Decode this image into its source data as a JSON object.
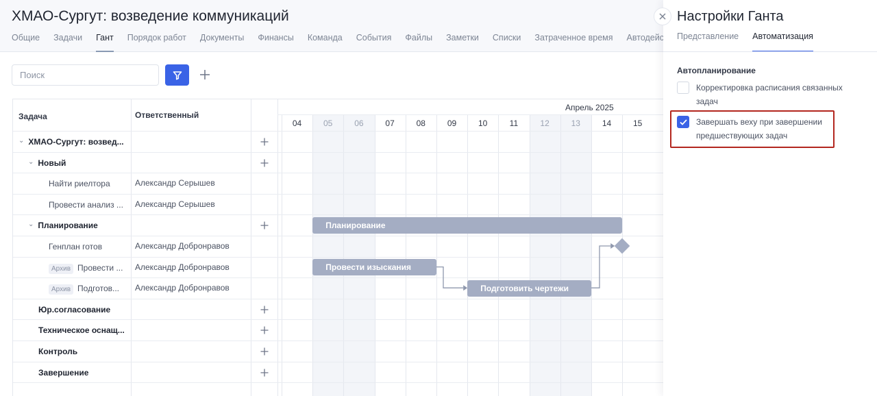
{
  "header": {
    "title": "ХМАО-Сургут: возведение коммуникаций",
    "tabs": [
      {
        "label": "Общие",
        "active": false
      },
      {
        "label": "Задачи",
        "active": false
      },
      {
        "label": "Гант",
        "active": true
      },
      {
        "label": "Порядок работ",
        "active": false
      },
      {
        "label": "Документы",
        "active": false
      },
      {
        "label": "Финансы",
        "active": false
      },
      {
        "label": "Команда",
        "active": false
      },
      {
        "label": "События",
        "active": false
      },
      {
        "label": "Файлы",
        "active": false
      },
      {
        "label": "Заметки",
        "active": false
      },
      {
        "label": "Списки",
        "active": false
      },
      {
        "label": "Затраченное время",
        "active": false
      },
      {
        "label": "Автодейс",
        "active": false
      }
    ]
  },
  "toolbar": {
    "search_placeholder": "Поиск",
    "filter_icon": "filter-icon",
    "add_icon": "plus-icon"
  },
  "table": {
    "col_task": "Задача",
    "col_owner": "Ответственный",
    "rows": [
      {
        "name": "ХМАО-Сургут: возвед...",
        "owner": "",
        "type": "group",
        "level": 0,
        "chevron": true,
        "plus": true,
        "badge": ""
      },
      {
        "name": "Новый",
        "owner": "",
        "type": "group",
        "level": 1,
        "chevron": true,
        "plus": true,
        "badge": ""
      },
      {
        "name": "Найти риелтора",
        "owner": "Александр Серышев",
        "type": "task",
        "level": 2,
        "chevron": false,
        "plus": false,
        "badge": ""
      },
      {
        "name": "Провести анализ ...",
        "owner": "Александр Серышев",
        "type": "task",
        "level": 2,
        "chevron": false,
        "plus": false,
        "badge": ""
      },
      {
        "name": "Планирование",
        "owner": "",
        "type": "group",
        "level": 1,
        "chevron": true,
        "plus": true,
        "badge": ""
      },
      {
        "name": "Генплан готов",
        "owner": "Александр Добронравов",
        "type": "task",
        "level": 2,
        "chevron": false,
        "plus": false,
        "badge": ""
      },
      {
        "name": "Провести ...",
        "owner": "Александр Добронравов",
        "type": "task",
        "level": 2,
        "chevron": false,
        "plus": false,
        "badge": "Архив"
      },
      {
        "name": "Подготов...",
        "owner": "Александр Добронравов",
        "type": "task",
        "level": 2,
        "chevron": false,
        "plus": false,
        "badge": "Архив"
      },
      {
        "name": "Юр.согласование",
        "owner": "",
        "type": "group",
        "level": 1,
        "chevron": false,
        "plus": true,
        "badge": ""
      },
      {
        "name": "Техническое оснащ...",
        "owner": "",
        "type": "group",
        "level": 1,
        "chevron": false,
        "plus": true,
        "badge": ""
      },
      {
        "name": "Контроль",
        "owner": "",
        "type": "group",
        "level": 1,
        "chevron": false,
        "plus": true,
        "badge": ""
      },
      {
        "name": "Завершение",
        "owner": "",
        "type": "group",
        "level": 1,
        "chevron": false,
        "plus": true,
        "badge": ""
      }
    ]
  },
  "gantt": {
    "month": "Апрель 2025",
    "days": [
      {
        "label": "04",
        "weekend": false
      },
      {
        "label": "05",
        "weekend": true
      },
      {
        "label": "06",
        "weekend": true
      },
      {
        "label": "07",
        "weekend": false
      },
      {
        "label": "08",
        "weekend": false
      },
      {
        "label": "09",
        "weekend": false
      },
      {
        "label": "10",
        "weekend": false
      },
      {
        "label": "11",
        "weekend": false
      },
      {
        "label": "12",
        "weekend": true
      },
      {
        "label": "13",
        "weekend": true
      },
      {
        "label": "14",
        "weekend": false
      },
      {
        "label": "15",
        "weekend": false
      }
    ],
    "bars": [
      {
        "label": "Планирование",
        "row": 4,
        "start": "05",
        "end": "14"
      },
      {
        "label": "Провести изыскания",
        "row": 6,
        "start": "05",
        "end": "08"
      },
      {
        "label": "Подготовить чертежи",
        "row": 7,
        "start": "10",
        "end": "13"
      }
    ],
    "milestones": [
      {
        "row": 5,
        "day": "15"
      }
    ],
    "bar_color": "#a4adc3"
  },
  "panel": {
    "title": "Настройки Ганта",
    "tabs": [
      {
        "label": "Представление",
        "active": false
      },
      {
        "label": "Автоматизация",
        "active": true
      }
    ],
    "section": "Автопланирование",
    "options": [
      {
        "label": "Корректировка расписания связанных задач",
        "checked": false
      },
      {
        "label": "Завершать веху при завершении предшествующих задач",
        "checked": true
      }
    ],
    "accent": "#3a63e6",
    "highlight_color": "#b3261e"
  }
}
